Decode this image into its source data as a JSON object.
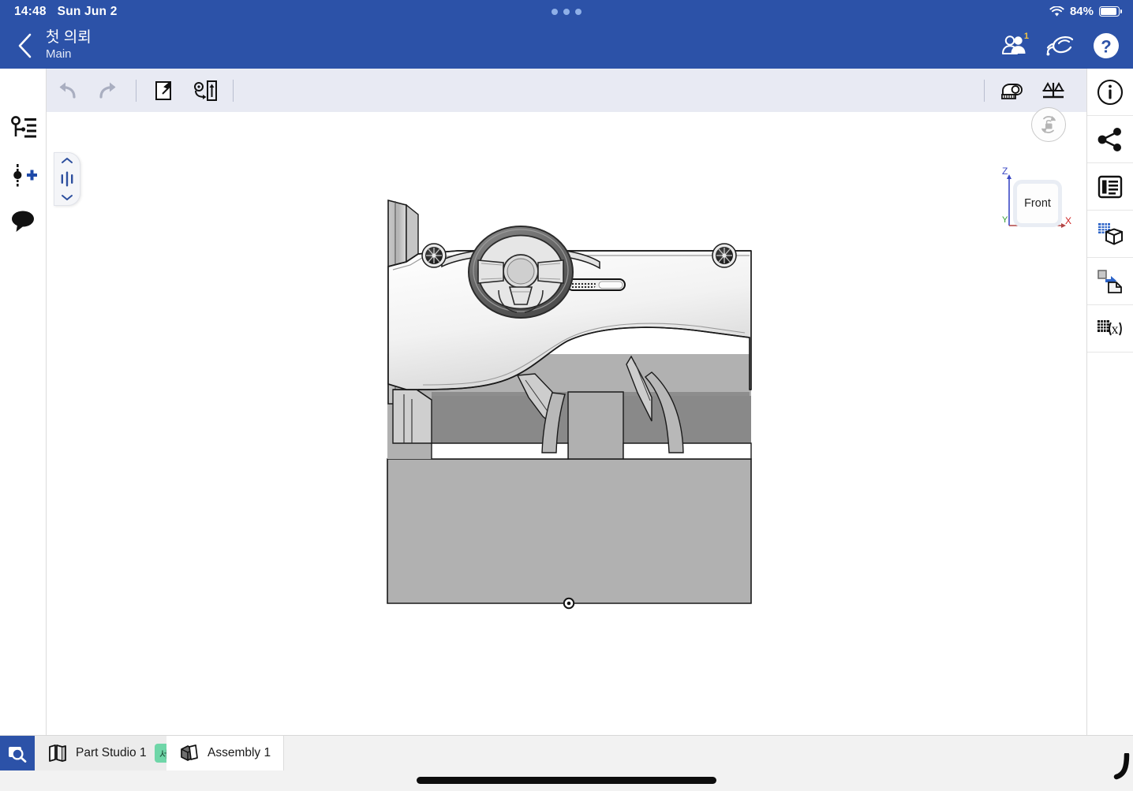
{
  "statusbar": {
    "time": "14:48",
    "date": "Sun Jun 2",
    "battery_percent": "84%",
    "wifi_icon": "wifi-icon",
    "battery_icon": "battery-icon",
    "multitask_icon": "multitask-dots-icon"
  },
  "appbar": {
    "back_icon": "chevron-left-icon",
    "document_name": "첫 의뢰",
    "workspace_name": "Main",
    "collaborators_icon": "users-icon",
    "collaborators_badge": "1",
    "follow_icon": "follow-mode-icon",
    "help_icon": "help-icon"
  },
  "left_toolbar": {
    "items": [
      {
        "name": "feature-list-icon",
        "label": "Feature list"
      },
      {
        "name": "add-instance-icon",
        "label": "Insert"
      },
      {
        "name": "comment-icon",
        "label": "Comments"
      }
    ]
  },
  "toolbar": {
    "undo_icon": "undo-icon",
    "redo_icon": "redo-icon",
    "insert_icon": "insert-part-icon",
    "mate_icon": "mate-connector-icon",
    "measure_icon": "measure-icon",
    "mass_properties_icon": "mass-properties-icon"
  },
  "right_toolbar": {
    "items": [
      {
        "name": "info-icon",
        "label": "Details"
      },
      {
        "name": "share-icon",
        "label": "Share"
      },
      {
        "name": "description-icon",
        "label": "Properties"
      },
      {
        "name": "bom-icon",
        "label": "Bill of materials"
      },
      {
        "name": "derive-icon",
        "label": "Derived"
      },
      {
        "name": "variables-icon",
        "label": "Variables"
      }
    ]
  },
  "viewport": {
    "rollback_handle_icon": "rollback-handle-icon",
    "rollback_up_icon": "chevron-up-icon",
    "rollback_down_icon": "chevron-down-icon",
    "rotate_lock_icon": "rotate-lock-icon",
    "view_cube_face": "Front",
    "axis_z": "Z",
    "axis_x": "X",
    "axis_y": "Y",
    "model_description": "Automotive dashboard assembly shown in front orthographic view",
    "origin_marker_icon": "origin-point-icon"
  },
  "tabbar": {
    "search_icon": "search-icon",
    "tabs": [
      {
        "name": "tab-part-studio-1",
        "label": "Part Studio 1",
        "icon": "part-studio-icon",
        "badge": "서",
        "active": false
      },
      {
        "name": "tab-assembly-1",
        "label": "Assembly 1",
        "icon": "assembly-icon",
        "badge": "",
        "active": true
      }
    ]
  },
  "colors": {
    "header_blue": "#2c52a8",
    "toolbar_gray": "#e8eaf3",
    "accent_blue": "#2d4f9e",
    "badge_green": "#6fd6a8",
    "badge_gold": "#f5c542",
    "axis_z_blue": "#3b49c4",
    "axis_x_red": "#cc2222",
    "axis_y_green": "#2a9a2a"
  }
}
